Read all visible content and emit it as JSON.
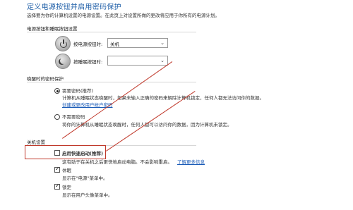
{
  "header": {
    "title": "定义电源按钮并启用密码保护",
    "description": "选择要为你的计算机设置的电源设置。在此页上对设置所做的更改将应用于你所有的电源计划。"
  },
  "power_buttons": {
    "section_title": "电源按钮和睡眠按钮设置",
    "power_button_label": "按电源按钮时:",
    "power_button_value": "关机",
    "sleep_button_label": "按睡眠按钮时:",
    "sleep_button_value": ""
  },
  "wake_password": {
    "section_title": "唤醒时的密码保护",
    "require_label": "需要密码(推荐)",
    "require_desc": "计算机从睡眠状态唤醒时，如果未输入正确的密码来解除计算机锁定，任何人都无法访问你的数据。",
    "require_link": "创建或更改用户帐户密码",
    "no_require_label": "不需要密码",
    "no_require_desc": "将你的计算机从睡眠状态唤醒时，任何人都可以访问你的数据，因为计算机未锁定。"
  },
  "shutdown": {
    "section_title": "关机设置",
    "fast_startup_label": "启用快速启动(推荐)",
    "fast_startup_desc": "这有助于在关机之后更快地启动电脑。不会影响重启。",
    "fast_startup_link": "了解更多信息",
    "sleep_label": "休眠",
    "sleep_desc": "显示在\"电源\"菜单中。",
    "lock_label": "锁定",
    "lock_desc": "显示在用户头像菜单中。"
  },
  "colors": {
    "accent_title": "#1f5fa8",
    "link": "#1a5bb7",
    "annotation": "#c0392b"
  }
}
